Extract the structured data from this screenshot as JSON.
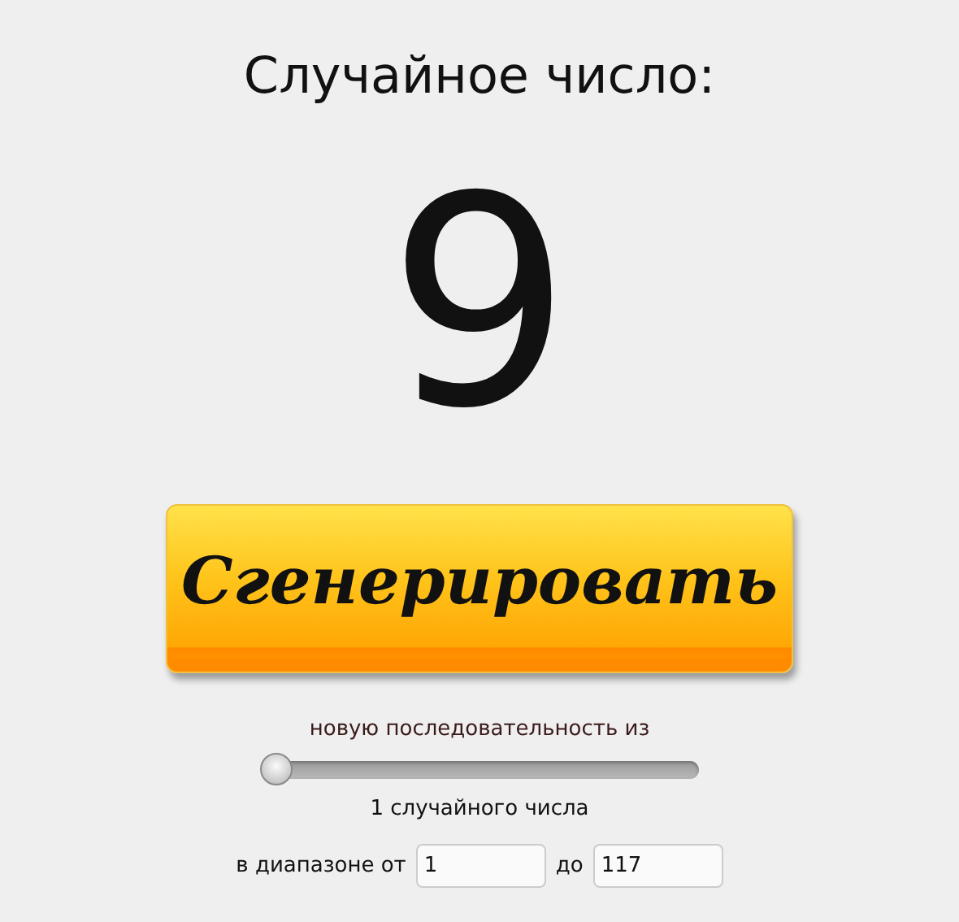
{
  "title": "Случайное число:",
  "result": "9",
  "generate_button": {
    "label": "Сгенерировать"
  },
  "sequence_label": "новую последовательность из",
  "count_slider": {
    "level": 0
  },
  "count_label": "1 случайного числа",
  "range": {
    "from_label": "в диапазоне от",
    "from_value": "1",
    "to_label": "до",
    "to_value": "117"
  }
}
